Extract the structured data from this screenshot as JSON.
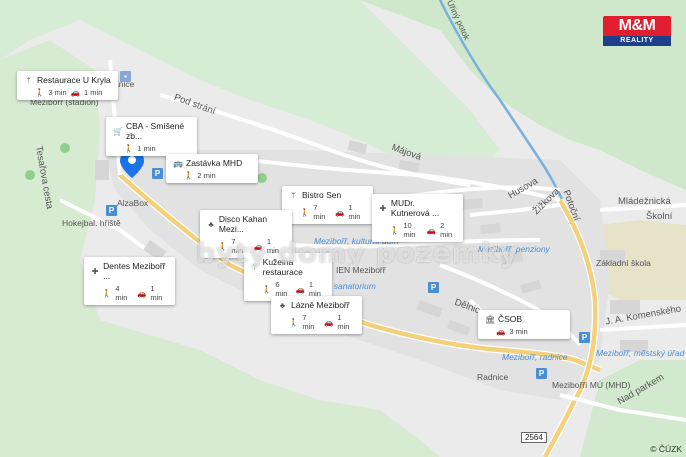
{
  "map": {
    "streets": [
      "Pod strání",
      "Májová",
      "Husova",
      "Žižkova",
      "Potoční",
      "Mládežnická",
      "Školní",
      "J. A. Komenského",
      "Dělnic",
      "Nad parkem",
      "Tesařova cesta",
      "Úřiný potok"
    ],
    "places": [
      "AlzaBox",
      "Hokejbal. hřiště",
      "Mezibořř (stadion)",
      "Stanice",
      "Základní škola",
      "Radnice",
      "Mezibořří MÚ (MHD)",
      "IEN Mezibořř"
    ],
    "transit_labels": [
      "Mezibořř, kulturní dům",
      "Mezibořř, penziony",
      "Mezibořř, sanatorium",
      "Mezibořř, radnice",
      "Mezibořř, městský úřad"
    ],
    "road_shield": "2564",
    "copyright": "© ČÚZK"
  },
  "pois": [
    {
      "name": "Restaurace U Kryla",
      "icon": "restaurant-icon",
      "walk": "3 min",
      "drive": "1 min"
    },
    {
      "name": "CBA - Smíšené zb...",
      "icon": "shop-icon",
      "walk": "1 min",
      "drive": ""
    },
    {
      "name": "Zastávka MHD",
      "icon": "bus-icon",
      "walk": "2 min",
      "drive": ""
    },
    {
      "name": "Bistro Sen",
      "icon": "restaurant-icon",
      "walk": "7 min",
      "drive": "1 min"
    },
    {
      "name": "MUDr. Kutnerová ...",
      "icon": "medical-icon",
      "walk": "10 min",
      "drive": "2 min"
    },
    {
      "name": "Disco Kahan Mezi...",
      "icon": "club-icon",
      "walk": "7 min",
      "drive": "1 min"
    },
    {
      "name": "Kuželna restaurace",
      "icon": "restaurant-icon",
      "walk": "6 min",
      "drive": "1 min"
    },
    {
      "name": "Dentes Mezibořř ...",
      "icon": "medical-icon",
      "walk": "4 min",
      "drive": "1 min"
    },
    {
      "name": "Lázně Mezibořř",
      "icon": "club-icon",
      "walk": "7 min",
      "drive": "1 min"
    },
    {
      "name": "ČSOB",
      "icon": "bank-icon",
      "walk": "",
      "drive": "3 min"
    }
  ],
  "logo": {
    "big": "M&M",
    "small": "REALITY"
  },
  "watermark": "byty domy pozemky"
}
